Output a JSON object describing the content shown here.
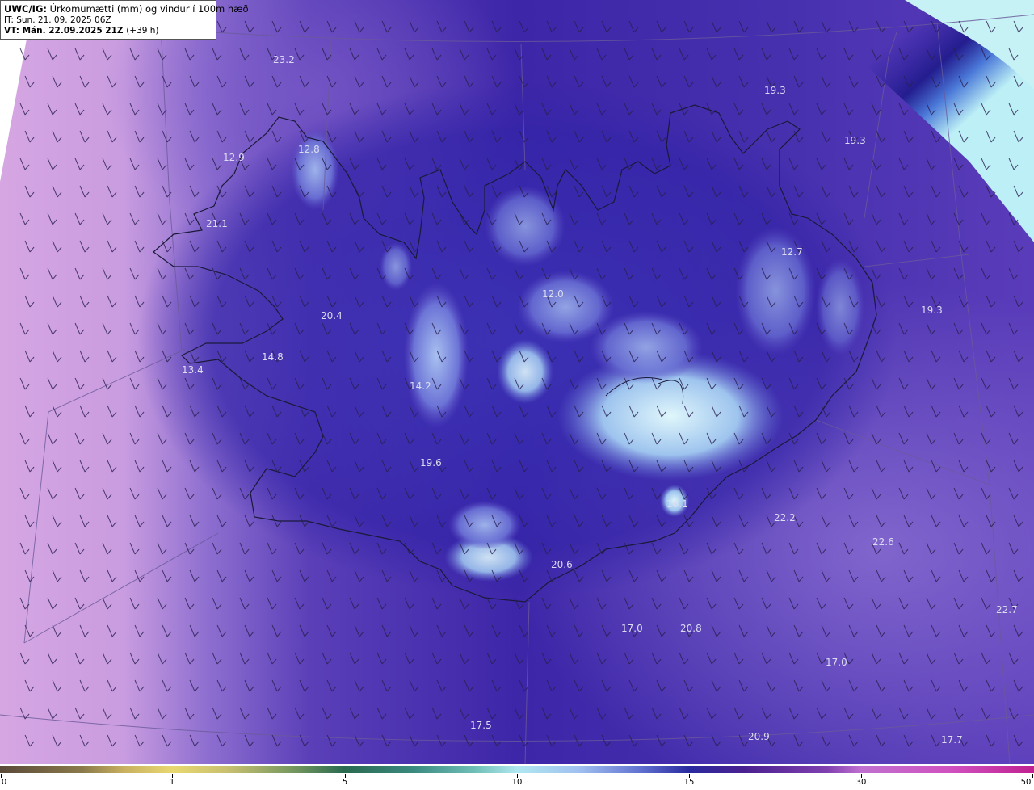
{
  "header": {
    "product": "UWC/IG:",
    "title": "Úrkomumætti (mm) og vindur í 100m hæð",
    "init_time": "IT: Sun. 21. 09. 2025 06Z",
    "valid_time": "VT: Mán. 22.09.2025 21Z",
    "lead": "(+39 h)"
  },
  "colorbar": {
    "ticks": [
      "0",
      "1",
      "5",
      "10",
      "15",
      "30",
      "50"
    ]
  },
  "map_values": [
    {
      "id": "v1",
      "text": "23.2"
    },
    {
      "id": "v2",
      "text": "19.3"
    },
    {
      "id": "v3",
      "text": "19.3"
    },
    {
      "id": "v4",
      "text": "12.9"
    },
    {
      "id": "v5",
      "text": "12.8"
    },
    {
      "id": "v6",
      "text": "21.1"
    },
    {
      "id": "v7",
      "text": "12.7"
    },
    {
      "id": "v8",
      "text": "12.0"
    },
    {
      "id": "v9",
      "text": "19.3"
    },
    {
      "id": "v10",
      "text": "20.4"
    },
    {
      "id": "v11",
      "text": "14.8"
    },
    {
      "id": "v12",
      "text": "13.4"
    },
    {
      "id": "v13",
      "text": "14.2"
    },
    {
      "id": "v14",
      "text": "19.6"
    },
    {
      "id": "v15",
      "text": "16.1"
    },
    {
      "id": "v16",
      "text": "22.2"
    },
    {
      "id": "v17",
      "text": "22.6"
    },
    {
      "id": "v18",
      "text": "20.6"
    },
    {
      "id": "v19",
      "text": "22.7"
    },
    {
      "id": "v20",
      "text": "17.0"
    },
    {
      "id": "v21",
      "text": "20.8"
    },
    {
      "id": "v22",
      "text": "17.0"
    },
    {
      "id": "v23",
      "text": "17.5"
    },
    {
      "id": "v24",
      "text": "20.9"
    },
    {
      "id": "v25",
      "text": "17.7"
    }
  ]
}
